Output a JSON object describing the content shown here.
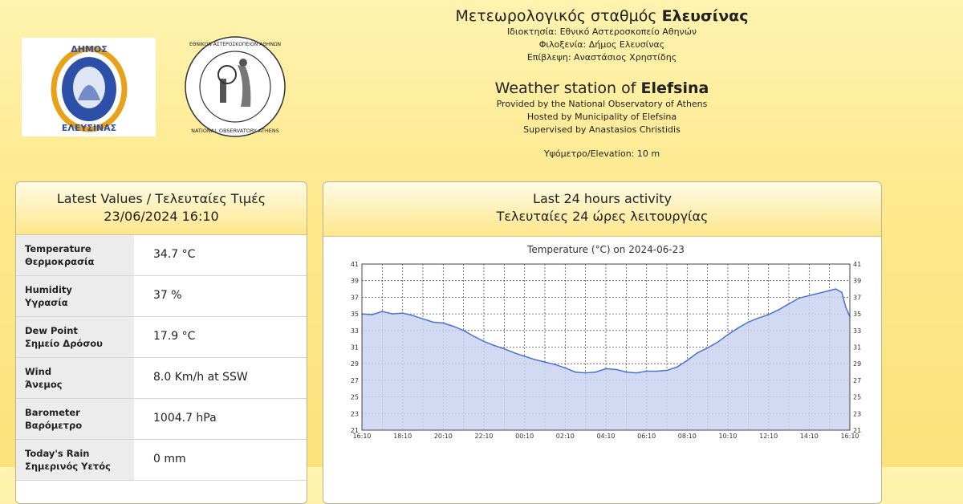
{
  "header": {
    "title_gr_prefix": "Μετεωρολογικός σταθμός ",
    "title_gr_bold": "Ελευσίνας",
    "owner_gr": "Ιδιοκτησία: Εθνικό Αστεροσκοπείο Αθηνών",
    "host_gr": "Φιλοξενία: Δήμος Ελευσίνας",
    "supervision_gr": "Επίβλεψη: Αναστάσιος Χρηστίδης",
    "title_en_prefix": "Weather station of ",
    "title_en_bold": "Elefsina",
    "provided_en": "Provided by the National Observatory of Athens",
    "hosted_en": "Hosted by Municipality of Elefsina",
    "supervised_en": "Supervised by Anastasios Christidis",
    "elevation": "Υψόμετρο/Elevation: 10 m"
  },
  "logos": {
    "municipality_top": "ΔΗΜΟΣ",
    "municipality_bottom": "ΕΛΕΥΣΙΝΑΣ",
    "observatory_top": "ΕΘΝΙΚΟΝ ΑΣΤΕΡΟΣΚΟΠΕΙΟΝ ΑΘΗΝΩΝ",
    "observatory_bottom": "NATIONAL OBSERVATORY ATHENS"
  },
  "latest": {
    "title": "Latest Values / Τελευταίες Τιμές",
    "datetime": "23/06/2024 16:10",
    "rows": [
      {
        "label_en": "Temperature",
        "label_gr": "Θερμοκρασία",
        "value": "34.7 °C"
      },
      {
        "label_en": "Humidity",
        "label_gr": "Υγρασία",
        "value": "37 %"
      },
      {
        "label_en": "Dew Point",
        "label_gr": "Σημείο Δρόσου",
        "value": "17.9 °C"
      },
      {
        "label_en": "Wind",
        "label_gr": "Άνεμος",
        "value": "8.0 Km/h at SSW"
      },
      {
        "label_en": "Barometer",
        "label_gr": "Βαρόμετρο",
        "value": "1004.7 hPa"
      },
      {
        "label_en": "Today's Rain",
        "label_gr": "Σημερινός Υετός",
        "value": "0 mm"
      }
    ]
  },
  "activity": {
    "title_en": "Last 24 hours activity",
    "title_gr": "Τελευταίες 24 ώρες λειτουργίας"
  },
  "colors": {
    "fill": "#c9d4f0",
    "line": "#4a72d0"
  },
  "chart_data": {
    "type": "area",
    "title": "Temperature (°C) on 2024-06-23",
    "x_ticks": [
      "16:10",
      "18:10",
      "20:10",
      "22:10",
      "00:10",
      "02:10",
      "04:10",
      "06:10",
      "08:10",
      "10:10",
      "12:10",
      "14:10",
      "16:10"
    ],
    "y_ticks": [
      21,
      23,
      25,
      27,
      29,
      31,
      33,
      35,
      37,
      39,
      41
    ],
    "ylim": [
      21,
      41
    ],
    "grid": true,
    "x_hours": [
      0,
      0.5,
      1,
      1.5,
      2,
      2.5,
      3,
      3.5,
      4,
      4.5,
      5,
      5.5,
      6,
      6.5,
      7,
      7.5,
      8,
      8.5,
      9,
      9.5,
      10,
      10.5,
      11,
      11.5,
      12,
      12.5,
      13,
      13.5,
      14,
      14.5,
      15,
      15.5,
      16,
      16.5,
      17,
      17.5,
      18,
      18.5,
      19,
      19.5,
      20,
      20.5,
      21,
      21.5,
      22,
      22.5,
      23,
      23.3,
      23.6,
      23.8,
      24
    ],
    "values": [
      35.0,
      34.9,
      35.3,
      35.0,
      35.1,
      34.8,
      34.4,
      34.0,
      33.9,
      33.5,
      33.0,
      32.3,
      31.7,
      31.2,
      30.8,
      30.3,
      29.9,
      29.5,
      29.2,
      28.9,
      28.5,
      28.0,
      27.9,
      28.0,
      28.4,
      28.3,
      28.0,
      27.9,
      28.1,
      28.1,
      28.2,
      28.6,
      29.4,
      30.3,
      30.9,
      31.6,
      32.5,
      33.3,
      34.0,
      34.5,
      34.9,
      35.5,
      36.2,
      36.9,
      37.2,
      37.5,
      37.8,
      38.0,
      37.6,
      35.8,
      34.7
    ]
  }
}
